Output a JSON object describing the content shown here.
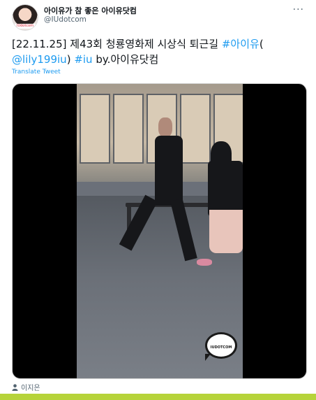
{
  "author": {
    "display_name": "아이유가 참 좋은 아이유닷컴",
    "handle": "@IUdotcom",
    "avatar_tag": "IUdotcom"
  },
  "tweet": {
    "text_plain_1": "[22.11.25] 제43회 청룡영화제 시상식 퇴근길 ",
    "hashtag_1": "#아이유",
    "paren_open": "(",
    "mention": "@lily199iu",
    "paren_close": ") ",
    "hashtag_2": "#iu",
    "text_plain_2": " by.아이유닷컴",
    "translate_label": "Translate Tweet",
    "more_label": "···"
  },
  "media": {
    "watermark_text": "IUDOTCOM"
  },
  "footer": {
    "tagged_user": "이지은"
  },
  "colors": {
    "link": "#1d9bf0",
    "bottom_bar": "#b6d33a"
  }
}
